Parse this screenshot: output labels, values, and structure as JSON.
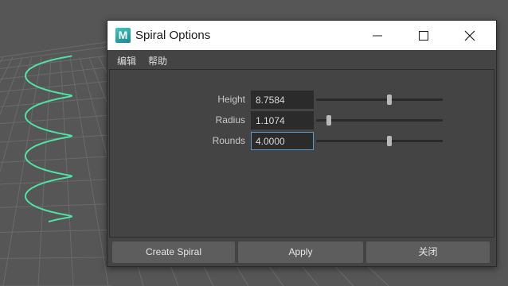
{
  "window": {
    "title": "Spiral Options",
    "logo_letter": "M",
    "controls": [
      "minimize-icon",
      "maximize-icon",
      "close-icon"
    ]
  },
  "menu": {
    "items": [
      {
        "label": "编辑"
      },
      {
        "label": "帮助"
      }
    ]
  },
  "fields": [
    {
      "label": "Height",
      "value": "8.7584",
      "slider_fraction": 0.58
    },
    {
      "label": "Radius",
      "value": "1.1074",
      "slider_fraction": 0.1
    },
    {
      "label": "Rounds",
      "value": "4.0000",
      "slider_fraction": 0.58
    }
  ],
  "buttons": {
    "create": "Create Spiral",
    "apply": "Apply",
    "close": "关闭"
  },
  "colors": {
    "spiral": "#4ee3a3",
    "viewport_bg": "#565656",
    "dialog_bg": "#444444",
    "focus": "#5d9ccc"
  }
}
